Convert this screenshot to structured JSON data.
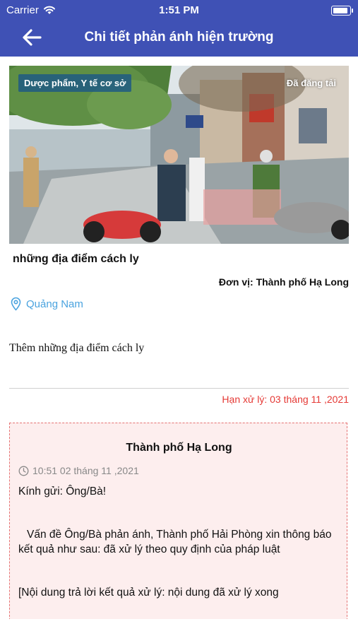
{
  "status_bar": {
    "carrier": "Carrier",
    "time": "1:51 PM",
    "battery_level": 0.9
  },
  "header": {
    "title": "Chi tiết phản ánh hiện trường"
  },
  "report": {
    "category": "Dược phẩm, Y tế cơ sở",
    "status": "Đã đăng tải",
    "subject": "những địa điểm cách ly",
    "unit": "Đơn vị: Thành phố Hạ Long",
    "location": "Quảng Nam",
    "description": "Thêm những địa điểm cách ly",
    "deadline": "Hạn xử lý: 03 tháng 11 ,2021"
  },
  "response": {
    "organization": "Thành phố Hạ Long",
    "timestamp": "10:51 02 tháng 11 ,2021",
    "greeting": "Kính gửi: Ông/Bà!",
    "result": "Vấn đề Ông/Bà phản ánh, Thành phố Hải Phòng xin thông báo kết quả như sau: đã xử lý theo quy định của pháp luật",
    "detail": "[Nội dung trả lời kết quả xử lý: nội dung đã xử lý xong"
  },
  "colors": {
    "header": "#3f51b5",
    "link": "#4aa3df",
    "deadline": "#e53935",
    "card_border": "#e57373",
    "card_bg": "#fdeeee"
  }
}
